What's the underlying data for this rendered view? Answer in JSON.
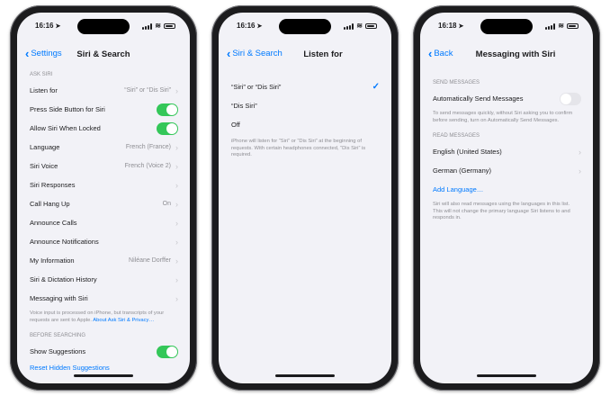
{
  "phone1": {
    "time": "16:16",
    "back_label": "Settings",
    "title": "Siri & Search",
    "section_ask": "ASK SIRI",
    "rows": [
      {
        "label": "Listen for",
        "value": "“Siri” or “Dis Siri”"
      },
      {
        "label": "Press Side Button for Siri"
      },
      {
        "label": "Allow Siri When Locked"
      },
      {
        "label": "Language",
        "value": "French (France)"
      },
      {
        "label": "Siri Voice",
        "value": "French (Voice 2)"
      },
      {
        "label": "Siri Responses"
      },
      {
        "label": "Call Hang Up",
        "value": "On"
      },
      {
        "label": "Announce Calls"
      },
      {
        "label": "Announce Notifications"
      },
      {
        "label": "My Information",
        "value": "Niléane Dorffer"
      },
      {
        "label": "Siri & Dictation History"
      },
      {
        "label": "Messaging with Siri"
      }
    ],
    "footnote": "Voice input is processed on iPhone, but transcripts of your requests are sent to Apple.",
    "footnote_link": "About Ask Siri & Privacy…",
    "section_before": "BEFORE SEARCHING",
    "show_suggestions": "Show Suggestions",
    "reset_hidden": "Reset Hidden Suggestions"
  },
  "phone2": {
    "time": "16:16",
    "back_label": "Siri & Search",
    "title": "Listen for",
    "options": [
      {
        "label": "“Siri” or “Dis Siri”",
        "selected": true
      },
      {
        "label": "“Dis Siri”",
        "selected": false
      },
      {
        "label": "Off",
        "selected": false
      }
    ],
    "checkmark": "✓",
    "footnote": "iPhone will listen for “Siri” or “Dis Siri” at the beginning of requests. With certain headphones connected, “Dis Siri” is required."
  },
  "phone3": {
    "time": "16:18",
    "back_label": "Back",
    "title": "Messaging with Siri",
    "section_send": "SEND MESSAGES",
    "auto_send": "Automatically Send Messages",
    "send_footnote": "To send messages quickly, without Siri asking you to confirm before sending, turn on Automatically Send Messages.",
    "section_read": "READ MESSAGES",
    "languages": [
      "English (United States)",
      "German (Germany)"
    ],
    "add_language": "Add Language…",
    "read_footnote": "Siri will also read messages using the languages in this list. This will not change the primary language Siri listens to and responds in."
  }
}
